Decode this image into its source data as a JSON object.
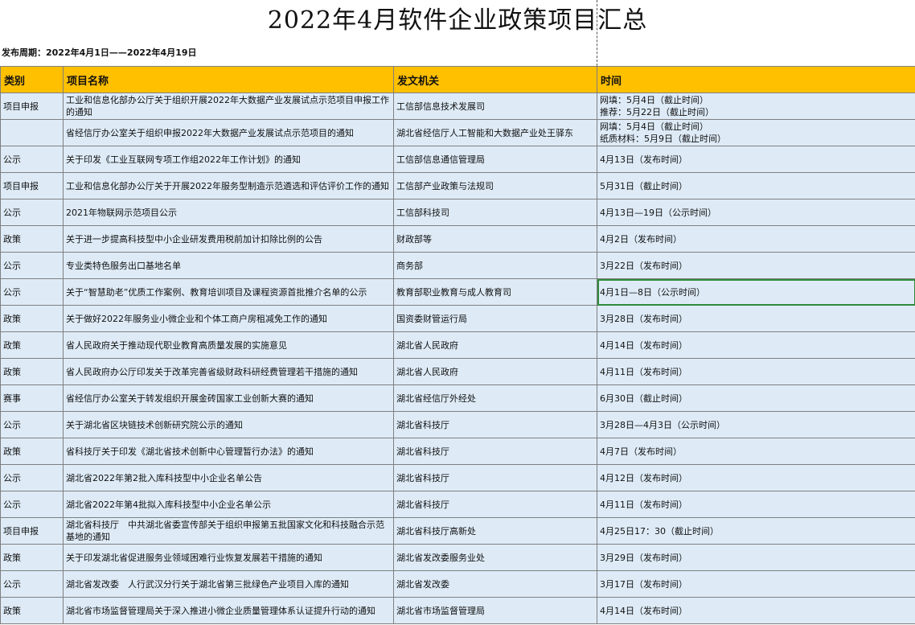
{
  "title": "2022年4月软件企业政策项目汇总",
  "period": "发布周期：2022年4月1日——2022年4月19日",
  "headers": [
    "类别",
    "项目名称",
    "发文机关",
    "时间"
  ],
  "rows": [
    {
      "cat": "项目申报",
      "name": "工业和信息化部办公厅关于组织开展2022年大数据产业发展试点示范项目申报工作的通知",
      "org": "工信部信息技术发展司",
      "time": "网填：5月4日（截止时间）\n推荐：5月22日（截止时间）"
    },
    {
      "cat": "",
      "name": "省经信厅办公室关于组织申报2022年大数据产业发展试点示范项目的通知",
      "org": "湖北省经信厅人工智能和大数据产业处王驿东",
      "time": "网填：5月4日（截止时间）\n纸质材料：5月9日（截止时间）"
    },
    {
      "cat": "公示",
      "name": "关于印发《工业互联网专项工作组2022年工作计划》的通知",
      "org": "工信部信息通信管理局",
      "time": "4月13日（发布时间）"
    },
    {
      "cat": "项目申报",
      "name": "工业和信息化部办公厅关于开展2022年服务型制造示范遴选和评估评价工作的通知",
      "org": "工信部产业政策与法规司",
      "time": "5月31日（截止时间）"
    },
    {
      "cat": "公示",
      "name": "2021年物联网示范项目公示",
      "org": "工信部科技司",
      "time": "4月13日—19日（公示时间）"
    },
    {
      "cat": "政策",
      "name": "关于进一步提高科技型中小企业研发费用税前加计扣除比例的公告",
      "org": "财政部等",
      "time": "4月2日（发布时间）"
    },
    {
      "cat": "公示",
      "name": "专业类特色服务出口基地名单",
      "org": "商务部",
      "time": "3月22日（发布时间）"
    },
    {
      "cat": "公示",
      "name": "关于“智慧助老”优质工作案例、教育培训项目及课程资源首批推介名单的公示",
      "org": "教育部职业教育与成人教育司",
      "time": "4月1日—8日（公示时间）"
    },
    {
      "cat": "政策",
      "name": "关于做好2022年服务业小微企业和个体工商户房租减免工作的通知",
      "org": "国资委财管运行局",
      "time": "3月28日（发布时间）"
    },
    {
      "cat": "政策",
      "name": "省人民政府关于推动现代职业教育高质量发展的实施意见",
      "org": "湖北省人民政府",
      "time": "4月14日（发布时间）"
    },
    {
      "cat": "政策",
      "name": "省人民政府办公厅印发关于改革完善省级财政科研经费管理若干措施的通知",
      "org": "湖北省人民政府",
      "time": "4月11日（发布时间）"
    },
    {
      "cat": "赛事",
      "name": "省经信厅办公室关于转发组织开展金砖国家工业创新大赛的通知",
      "org": "湖北省经信厅外经处",
      "time": "6月30日（截止时间）"
    },
    {
      "cat": "公示",
      "name": "关于湖北省区块链技术创新研究院公示的通知",
      "org": "湖北省科技厅",
      "time": "3月28日—4月3日（公示时间）"
    },
    {
      "cat": "政策",
      "name": "省科技厅关于印发《湖北省技术创新中心管理暂行办法》的通知",
      "org": "湖北省科技厅",
      "time": "4月7日（发布时间）"
    },
    {
      "cat": "公示",
      "name": "湖北省2022年第2批入库科技型中小企业名单公告",
      "org": "湖北省科技厅",
      "time": "4月12日（发布时间）"
    },
    {
      "cat": "公示",
      "name": "湖北省2022年第4批拟入库科技型中小企业名单公示",
      "org": "湖北省科技厅",
      "time": "4月11日（发布时间）"
    },
    {
      "cat": "项目申报",
      "name": "湖北省科技厅　中共湖北省委宣传部关于组织申报第五批国家文化和科技融合示范基地的通知",
      "org": "湖北省科技厅高新处",
      "time": "4月25日17：30（截止时间）"
    },
    {
      "cat": "政策",
      "name": "关于印发湖北省促进服务业领域困难行业恢复发展若干措施的通知",
      "org": "湖北省发改委服务业处",
      "time": "3月29日（发布时间）"
    },
    {
      "cat": "公示",
      "name": "湖北省发改委　人行武汉分行关于湖北省第三批绿色产业项目入库的通知",
      "org": "湖北省发改委",
      "time": "3月17日（发布时间）"
    },
    {
      "cat": "政策",
      "name": "湖北省市场监督管理局关于深入推进小微企业质量管理体系认证提升行动的通知",
      "org": "湖北省市场监督管理局",
      "time": "4月14日（发布时间）"
    }
  ]
}
